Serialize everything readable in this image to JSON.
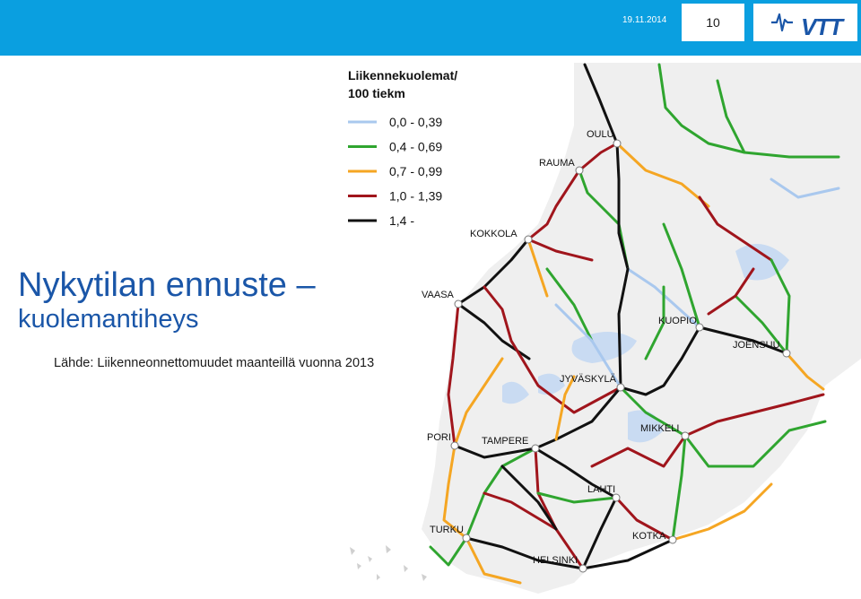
{
  "header": {
    "date": "19.11.2014",
    "page_number": "10",
    "logo_text": "VTT",
    "colors": {
      "bar": "#0a9fe0",
      "logo": "#1a56a8"
    }
  },
  "slide": {
    "title": "Nykytilan ennuste –",
    "subtitle": "kuolemantiheys",
    "source": "Lähde: Liikenneonnettomuudet maanteillä vuonna 2013"
  },
  "legend": {
    "title_line1": "Liikennekuolemat/",
    "title_line2": "100 tiekm",
    "items": [
      {
        "label": "0,0 - 0,39",
        "color": "#a9c8ee"
      },
      {
        "label": "0,4 - 0,69",
        "color": "#2fa52f"
      },
      {
        "label": "0,7 - 0,99",
        "color": "#f5a623"
      },
      {
        "label": "1,0 - 1,39",
        "color": "#a0151c"
      },
      {
        "label": "1,4 -",
        "color": "#111111"
      }
    ]
  },
  "cities": [
    {
      "id": "oulu",
      "name": "OULU"
    },
    {
      "id": "rauma",
      "name": "RAUMA"
    },
    {
      "id": "kokkola",
      "name": "KOKKOLA"
    },
    {
      "id": "vaasa",
      "name": "VAASA"
    },
    {
      "id": "kuopio",
      "name": "KUOPIO"
    },
    {
      "id": "joensuu",
      "name": "JOENSUU"
    },
    {
      "id": "jyvaskyla",
      "name": "JYVÄSKYLÄ"
    },
    {
      "id": "mikkeli",
      "name": "MIKKELI"
    },
    {
      "id": "pori",
      "name": "PORI"
    },
    {
      "id": "tampere",
      "name": "TAMPERE"
    },
    {
      "id": "lahti",
      "name": "LAHTI"
    },
    {
      "id": "turku",
      "name": "TURKU"
    },
    {
      "id": "kotka",
      "name": "KOTKA"
    },
    {
      "id": "helsinki",
      "name": "HELSINKI"
    }
  ]
}
